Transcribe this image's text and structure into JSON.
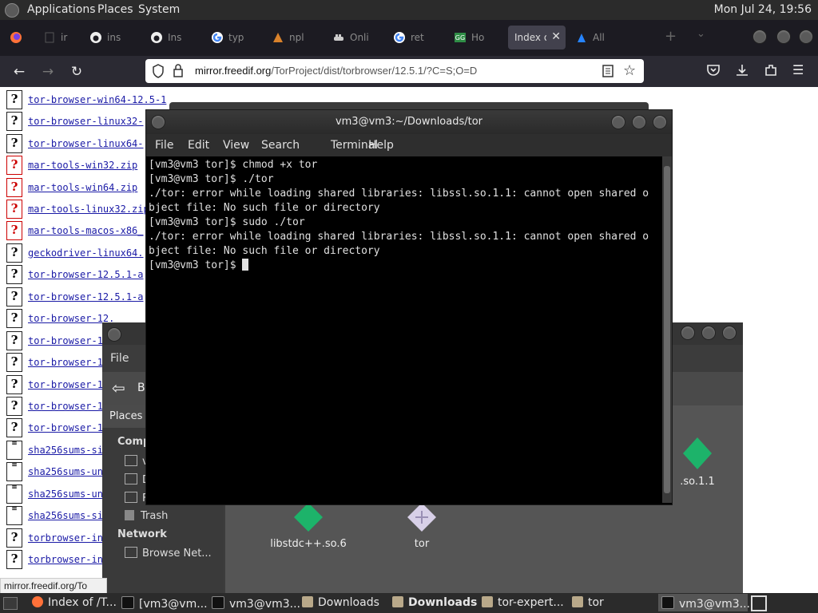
{
  "top_panel": {
    "menus": [
      "Applications",
      "Places",
      "System"
    ],
    "clock": "Mon Jul 24, 19:56"
  },
  "browser": {
    "tabs": [
      {
        "icon": "firefox-icon",
        "title": ""
      },
      {
        "icon": "blank-icon",
        "title": "ir"
      },
      {
        "icon": "github-icon",
        "title": "ins"
      },
      {
        "icon": "github-icon",
        "title": "Ins"
      },
      {
        "icon": "google-icon",
        "title": "typ"
      },
      {
        "icon": "page-icon",
        "title": "npl"
      },
      {
        "icon": "docker-icon",
        "title": "Onli"
      },
      {
        "icon": "google-icon",
        "title": "ret"
      },
      {
        "icon": "gfg-icon",
        "title": "Ho"
      },
      {
        "icon": "none",
        "title": "Index o",
        "active": true
      },
      {
        "icon": "atlassian-icon",
        "title": "All"
      }
    ],
    "url_domain": "mirror.freedif.org",
    "url_path": "/TorProject/dist/torbrowser/12.5.1/?C=S;O=D",
    "status_url": "mirror.freedif.org/To"
  },
  "listing": {
    "rows": [
      {
        "kind": "unknown",
        "name": "tor-browser-win64-12.5-1"
      },
      {
        "kind": "unknown",
        "name": "tor-browser-linux32-"
      },
      {
        "kind": "unknown",
        "name": "tor-browser-linux64-"
      },
      {
        "kind": "archive",
        "name": "mar-tools-win32.zip"
      },
      {
        "kind": "archive",
        "name": "mar-tools-win64.zip"
      },
      {
        "kind": "archive",
        "name": "mar-tools-linux32.zip"
      },
      {
        "kind": "archive",
        "name": "mar-tools-macos-x86_"
      },
      {
        "kind": "unknown",
        "name": "geckodriver-linux64."
      },
      {
        "kind": "unknown",
        "name": "tor-browser-12.5.1-a"
      },
      {
        "kind": "unknown",
        "name": "tor-browser-12.5.1-a"
      },
      {
        "kind": "unknown",
        "name": "tor-browser-12."
      },
      {
        "kind": "unknown",
        "name": "tor-browser-1"
      },
      {
        "kind": "unknown",
        "name": "tor-browser-1"
      },
      {
        "kind": "unknown",
        "name": "tor-browser-1"
      },
      {
        "kind": "unknown",
        "name": "tor-browser-1"
      },
      {
        "kind": "unknown",
        "name": "tor-browser-1"
      },
      {
        "kind": "text",
        "name": "sha256sums-si"
      },
      {
        "kind": "text",
        "name": "sha256sums-un"
      },
      {
        "kind": "text",
        "name": "sha256sums-un"
      },
      {
        "kind": "text",
        "name": "sha256sums-si"
      },
      {
        "kind": "unknown",
        "name": "torbrowser-in"
      },
      {
        "kind": "unknown",
        "name": "torbrowser-in"
      }
    ]
  },
  "terminal": {
    "title": "vm3@vm3:~/Downloads/tor",
    "menu": [
      "File",
      "Edit",
      "View",
      "Search",
      "Terminal",
      "Help"
    ],
    "lines": [
      "[vm3@vm3 tor]$ chmod +x tor",
      "[vm3@vm3 tor]$ ./tor",
      "./tor: error while loading shared libraries: libssl.so.1.1: cannot open shared o",
      "bject file: No such file or directory",
      "[vm3@vm3 tor]$ sudo ./tor",
      "./tor: error while loading shared libraries: libssl.so.1.1: cannot open shared o",
      "bject file: No such file or directory"
    ],
    "prompt": "[vm3@vm3 tor]$ "
  },
  "file_manager": {
    "menu_file": "File",
    "back_label": "B",
    "places_label": "Places",
    "computer_head": "Comp",
    "side_items_partial": [
      "v",
      "D",
      "F"
    ],
    "trash": "Trash",
    "network_head": "Network",
    "browse_net": "Browse Net...",
    "files": [
      {
        "name": "libstdc++.so.6",
        "icon": "library-icon"
      },
      {
        "name": "tor",
        "icon": "executable-icon"
      },
      {
        "name": ".so.1.1",
        "icon": "library-icon"
      }
    ]
  },
  "taskbar": {
    "items": [
      {
        "icon": "firefox-icon",
        "label": "Index of /T..."
      },
      {
        "icon": "terminal-icon",
        "label": "[vm3@vm..."
      },
      {
        "icon": "terminal-icon",
        "label": "vm3@vm3..."
      },
      {
        "icon": "folder-icon",
        "label": "Downloads"
      },
      {
        "icon": "folder-icon",
        "label": "Downloads",
        "bold": true
      },
      {
        "icon": "folder-icon",
        "label": "tor-expert..."
      },
      {
        "icon": "folder-icon",
        "label": "tor"
      },
      {
        "icon": "terminal-icon",
        "label": "vm3@vm3...",
        "active": true
      }
    ]
  },
  "colors": {
    "panel_bg": "#2b2b2b",
    "terminal_bg": "#000000",
    "link": "#1a1aa6",
    "file_icon_green": "#1db36a"
  }
}
